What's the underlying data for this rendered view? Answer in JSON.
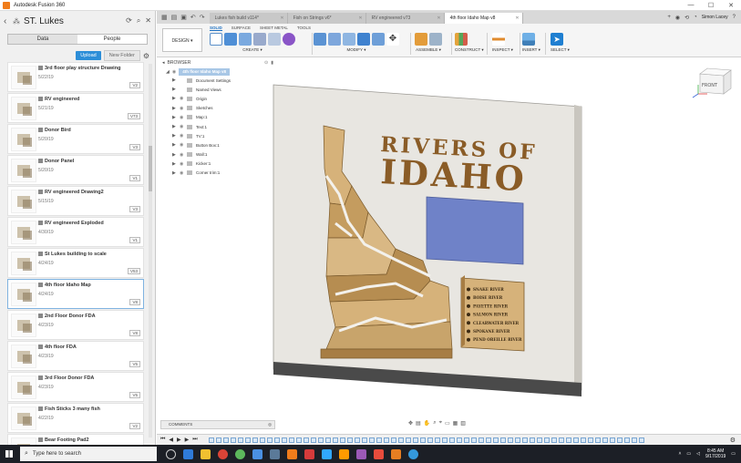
{
  "window": {
    "title": "Autodesk Fusion 360",
    "controls": [
      "—",
      "☐",
      "✕"
    ]
  },
  "data_panel": {
    "project": "ST. Lukes",
    "tabs": [
      {
        "label": "Data",
        "active": true
      },
      {
        "label": "People",
        "active": false
      }
    ],
    "upload_label": "Upload",
    "new_folder_label": "New Folder",
    "files": [
      {
        "name": "3rd floor play structure Drawing",
        "date": "5/22/19",
        "version": "V2"
      },
      {
        "name": "RV engineered",
        "date": "5/21/19",
        "version": "V73"
      },
      {
        "name": "Donor Bird",
        "date": "5/20/19",
        "version": "V3"
      },
      {
        "name": "Donor Panel",
        "date": "5/20/19",
        "version": "V1"
      },
      {
        "name": "RV engineered Drawing2",
        "date": "5/15/19",
        "version": "V3"
      },
      {
        "name": "RV engineered Exploded",
        "date": "4/30/19",
        "version": "V1"
      },
      {
        "name": "St Lukes building to scale",
        "date": "4/24/19",
        "version": "V53"
      },
      {
        "name": "4th floor Idaho Map",
        "date": "4/24/19",
        "version": "V8",
        "selected": true
      },
      {
        "name": "2nd Floor Donor FDA",
        "date": "4/23/19",
        "version": "V8"
      },
      {
        "name": "4th floor FDA",
        "date": "4/23/19",
        "version": "V5"
      },
      {
        "name": "3rd Floor Donor FDA",
        "date": "4/23/19",
        "version": "V5"
      },
      {
        "name": "Fish Sticks 3 many fish",
        "date": "4/22/19",
        "version": "V2"
      },
      {
        "name": "Bear Footing Pad2",
        "date": "4/16/19",
        "version": ""
      }
    ]
  },
  "doc_tabs": [
    {
      "label": "Lukes fish build v114*",
      "active": false
    },
    {
      "label": "Fish on Strings v6*",
      "active": false
    },
    {
      "label": "RV engineered v73",
      "active": false
    },
    {
      "label": "4th floor Idaho Map v8",
      "active": true
    }
  ],
  "user": "Simon Lacey",
  "toolbar": {
    "design_label": "DESIGN ▾",
    "workspace_tabs": [
      {
        "label": "SOLID",
        "active": true
      },
      {
        "label": "SURFACE",
        "active": false
      },
      {
        "label": "SHEET METAL",
        "active": false
      },
      {
        "label": "TOOLS",
        "active": false
      }
    ],
    "groups": {
      "create": "CREATE ▾",
      "modify": "MODIFY ▾",
      "assemble": "ASSEMBLE ▾",
      "construct": "CONSTRUCT ▾",
      "inspect": "INSPECT ▾",
      "insert": "INSERT ▾",
      "select": "SELECT ▾"
    }
  },
  "browser": {
    "header": "BROWSER",
    "root": "4th floor Idaho Map v8",
    "nodes": [
      "Document Settings",
      "Named Views",
      "Origin",
      "Sketches",
      "Map:1",
      "Text:1",
      "TV:1",
      "Button Box:1",
      "Wall:1",
      "Kicker:1",
      "Corner trim:1"
    ]
  },
  "model": {
    "title_line1": "RIVERS OF",
    "title_line2": "IDAHO",
    "rivers": [
      "SNAKE RIVER",
      "BOISE RIVER",
      "PAYETTE RIVER",
      "SALMON RIVER",
      "CLEARWATER RIVER",
      "SPOKANE RIVER",
      "PEND OREILLE RIVER"
    ],
    "viewcube_label": "FRONT",
    "colors": {
      "wood": "#d6b27a",
      "wood_dark": "#a77d44",
      "tv": "#6f82c8",
      "wall": "#e8e6e1"
    }
  },
  "comments": {
    "label": "COMMENTS"
  },
  "taskbar": {
    "search_placeholder": "Type here to search",
    "time": "8:45 AM",
    "date": "9/17/2019"
  }
}
